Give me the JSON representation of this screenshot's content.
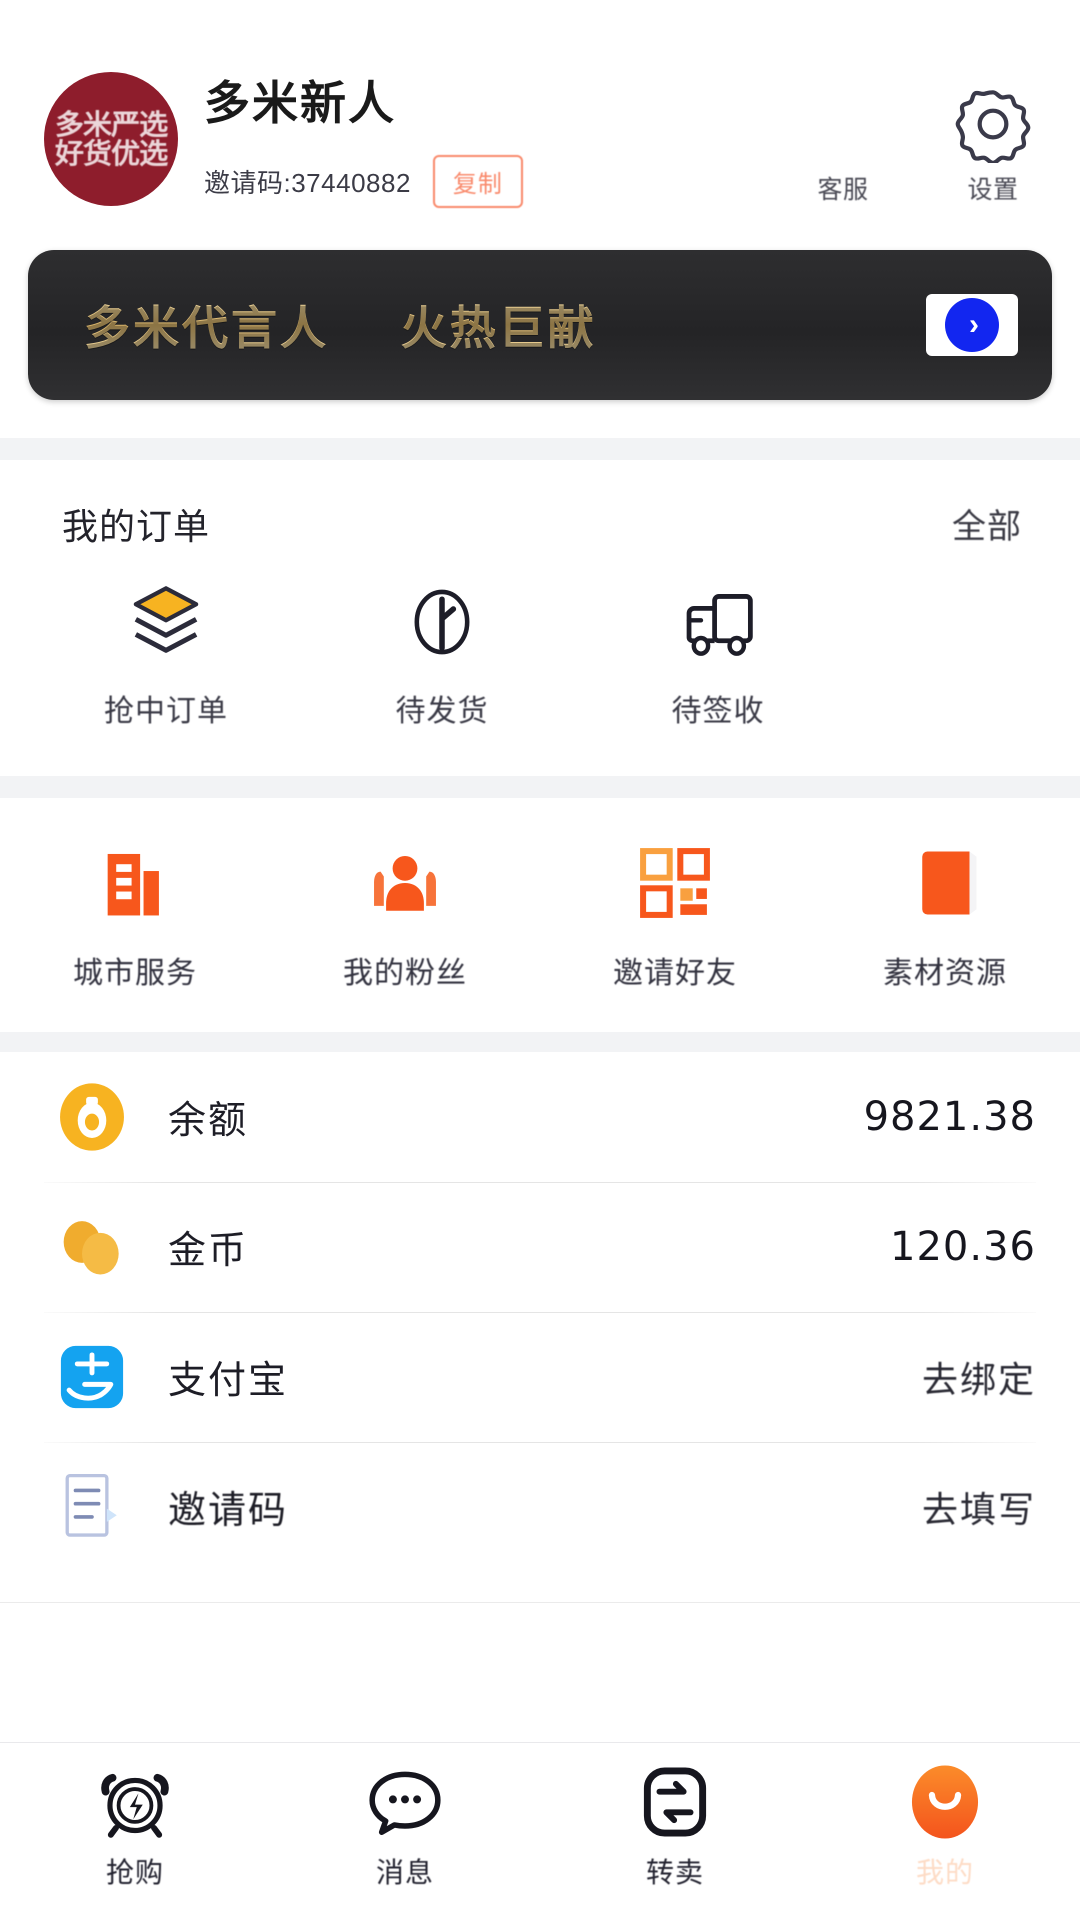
{
  "profile": {
    "avatar_text": "多米严选\n好货优选",
    "avatar_icon": "user-avatar",
    "nickname": "多米新人",
    "id_label": "邀请码:37440882",
    "copy_button": "复制",
    "actions": [
      {
        "icon": "headset-icon",
        "label": "客服"
      },
      {
        "icon": "gear-icon",
        "label": "设置"
      }
    ]
  },
  "banner": {
    "text_main": "多米代言人",
    "text_sub": "火热巨献",
    "arrow_icon": "chevron-right-icon",
    "arrow_glyph": "›"
  },
  "orders": {
    "title": "我的订单",
    "all_label": "全部",
    "items": [
      {
        "icon": "layers-icon",
        "label": "抢中订单"
      },
      {
        "icon": "clock-icon",
        "label": "待发货"
      },
      {
        "icon": "truck-icon",
        "label": "待签收"
      }
    ]
  },
  "features": [
    {
      "icon": "city-building-icon",
      "label": "城市服务"
    },
    {
      "icon": "fans-people-icon",
      "label": "我的粉丝"
    },
    {
      "icon": "qr-grid-icon",
      "label": "邀请好友"
    },
    {
      "icon": "material-book-icon",
      "label": "素材资源"
    }
  ],
  "assets": [
    {
      "icon": "wallet-balance-icon",
      "label": "余额",
      "value": "9821.38",
      "value_type": "amount"
    },
    {
      "icon": "gold-coins-icon",
      "label": "金币",
      "value": "120.36",
      "value_type": "amount"
    },
    {
      "icon": "alipay-icon",
      "label": "支付宝",
      "value": "去绑定",
      "value_type": "action"
    },
    {
      "icon": "invite-code-icon",
      "label": "邀请码",
      "value": "去填写",
      "value_type": "action"
    }
  ],
  "tabbar": [
    {
      "icon": "alarm-flash-icon",
      "label": "抢购",
      "active": false
    },
    {
      "icon": "message-bubble-icon",
      "label": "消息",
      "active": false
    },
    {
      "icon": "resell-exchange-icon",
      "label": "转卖",
      "active": false
    },
    {
      "icon": "profile-avatar-icon",
      "label": "我的",
      "active": true
    }
  ],
  "colors": {
    "accent_orange": "#f7741e",
    "gold": "#d8b369",
    "banner_bg": "#2b2b2d",
    "avatar_red": "#8e1d2c",
    "alipay_blue": "#1296db",
    "coin_yellow": "#f5b320",
    "copy_border": "#f98a6c",
    "arrow_blue": "#1226f0"
  }
}
